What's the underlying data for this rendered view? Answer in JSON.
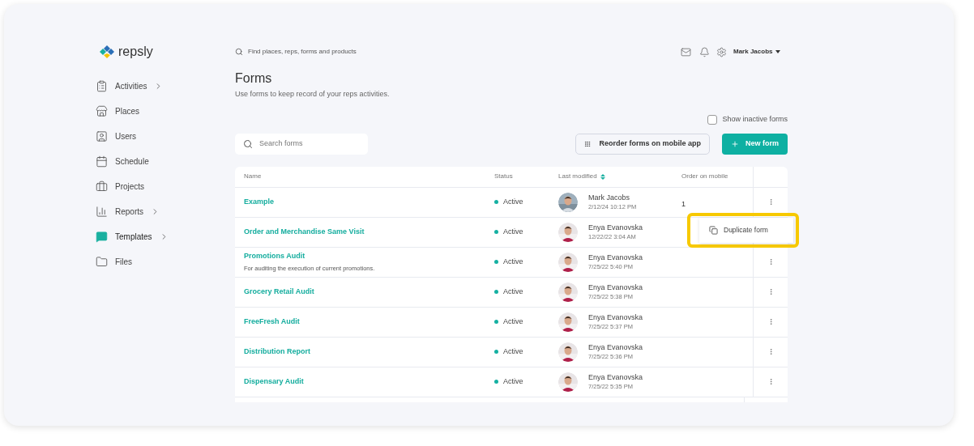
{
  "brand": {
    "name": "repsly"
  },
  "topbar": {
    "search_placeholder": "Find places, reps, forms and products",
    "user": "Mark Jacobs"
  },
  "sidebar": {
    "items": [
      {
        "label": "Activities",
        "has_submenu": true,
        "selected": false
      },
      {
        "label": "Places",
        "has_submenu": false,
        "selected": false
      },
      {
        "label": "Users",
        "has_submenu": false,
        "selected": false
      },
      {
        "label": "Schedule",
        "has_submenu": false,
        "selected": false
      },
      {
        "label": "Projects",
        "has_submenu": false,
        "selected": false
      },
      {
        "label": "Reports",
        "has_submenu": true,
        "selected": false
      },
      {
        "label": "Templates",
        "has_submenu": true,
        "selected": true
      },
      {
        "label": "Files",
        "has_submenu": false,
        "selected": false
      }
    ]
  },
  "page": {
    "title": "Forms",
    "subtitle": "Use forms to keep record of your reps activities."
  },
  "show_inactive": {
    "label": "Show inactive forms",
    "checked": false
  },
  "search": {
    "placeholder": "Search forms"
  },
  "buttons": {
    "reorder": "Reorder forms on mobile app",
    "new": "New form"
  },
  "table": {
    "columns": [
      "Name",
      "Status",
      "Last modified",
      "Order on mobile"
    ],
    "rows": [
      {
        "name": "Example",
        "status": "Active",
        "user": "Mark Jacobs",
        "date": "2/12/24 10:12 PM",
        "order": "1",
        "menu_open": false
      },
      {
        "name": "Order and Merchandise Same Visit",
        "status": "Active",
        "user": "Enya Evanovska",
        "date": "12/22/22 3:04 AM",
        "menu_open": true
      },
      {
        "name": "Promotions Audit",
        "description": "For auditing the execution of current promotions.",
        "status": "Active",
        "user": "Enya Evanovska",
        "date": "7/25/22 5:40 PM",
        "menu_open": false
      },
      {
        "name": "Grocery Retail Audit",
        "status": "Active",
        "user": "Enya Evanovska",
        "date": "7/25/22 5:38 PM",
        "menu_open": false
      },
      {
        "name": "FreeFresh Audit",
        "status": "Active",
        "user": "Enya Evanovska",
        "date": "7/25/22 5:37 PM",
        "menu_open": false
      },
      {
        "name": "Distribution Report",
        "status": "Active",
        "user": "Enya Evanovska",
        "date": "7/25/22 5:36 PM",
        "menu_open": false
      },
      {
        "name": "Dispensary Audit",
        "status": "Active",
        "user": "Enya Evanovska",
        "date": "7/25/22 5:35 PM",
        "menu_open": false
      }
    ]
  },
  "row_menu": {
    "items": [
      "Duplicate form"
    ]
  }
}
